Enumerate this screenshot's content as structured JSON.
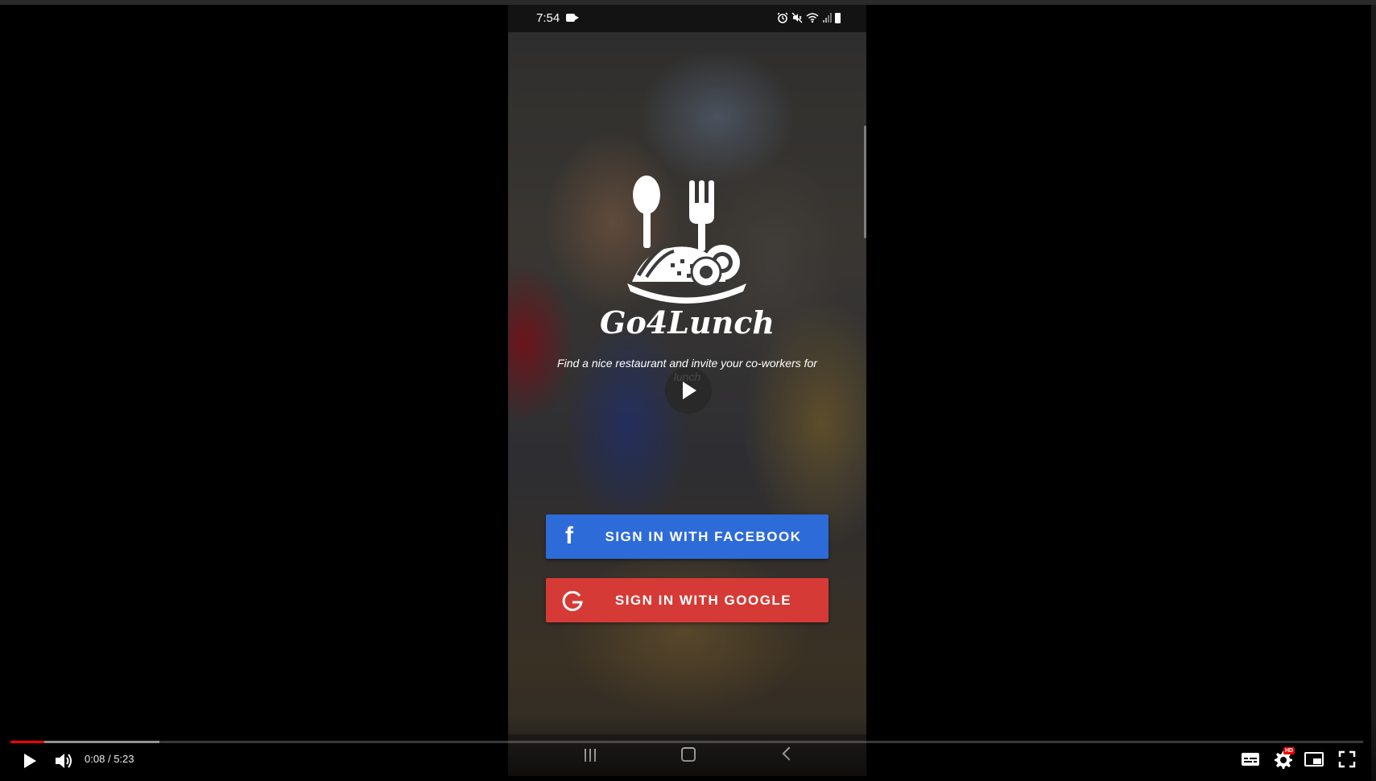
{
  "phone": {
    "status_bar": {
      "time": "7:54",
      "icons": [
        "video-recording-icon",
        "alarm-icon",
        "mute-icon",
        "wifi-icon",
        "signal-icon",
        "battery-icon"
      ]
    },
    "app_name": "Go4Lunch",
    "tagline": "Find a nice restaurant and invite your co-workers for lunch",
    "buttons": {
      "facebook_label": "SIGN IN WITH FACEBOOK",
      "google_label": "SIGN IN WITH GOOGLE",
      "facebook_color": "#2d6bd8",
      "google_color": "#d63a36"
    },
    "nav_bar": [
      "recent-apps-icon",
      "home-icon",
      "back-icon"
    ]
  },
  "player": {
    "time_current": "0:08",
    "time_separator": "/",
    "time_total": "5:23",
    "progress_played": 0.025,
    "progress_buffered": 0.11,
    "accent_color": "#ff0000",
    "hd_badge": "HD"
  }
}
